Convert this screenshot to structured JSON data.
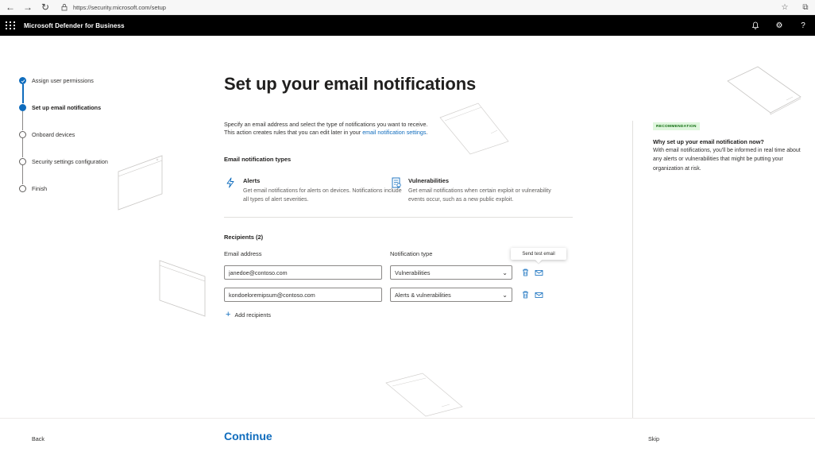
{
  "browser": {
    "url": "https://security.microsoft.com/setup"
  },
  "app": {
    "title": "Microsoft Defender for Business"
  },
  "steps": [
    {
      "label": "Assign user permissions",
      "state": "done"
    },
    {
      "label": "Set up email notifications",
      "state": "current"
    },
    {
      "label": "Onboard devices",
      "state": "pending"
    },
    {
      "label": "Security settings configuration",
      "state": "pending"
    },
    {
      "label": "Finish",
      "state": "pending"
    }
  ],
  "main": {
    "title": "Set up your email notifications",
    "intro_line1": "Specify an email address and select the type of  notifications you want to receive.",
    "intro_line2_prefix": "This action creates rules that you can edit later in your ",
    "intro_link": "email notification settings",
    "intro_suffix": ".",
    "types_heading": "Email notification types",
    "alerts": {
      "title": "Alerts",
      "desc": "Get email notifications for alerts on devices. Notifications include all types of alert severities.",
      "icon": "lightning-icon"
    },
    "vulnerabilities": {
      "title": "Vulnerabilities",
      "desc": "Get email notifications when certain exploit or vulnerability events occur, such as a new public exploit.",
      "icon": "report-icon"
    },
    "recipients_heading": "Recipients (2)",
    "col_email": "Email address",
    "col_type": "Notification type",
    "tooltip": "Send test email",
    "recipients": [
      {
        "email": "janedoe@contoso.com",
        "type": "Vulnerabilities"
      },
      {
        "email": "kondoeloremipsum@contoso.com",
        "type": "Alerts & vulnerabilities"
      }
    ],
    "add_recipients": "Add recipients"
  },
  "panel": {
    "badge": "RECOMMENDATION",
    "heading": "Why set up your email notification now?",
    "body": "With email notifications, you'll be informed in real time about any alerts or vulnerabilities that might be putting your organization at risk."
  },
  "footer": {
    "back": "Back",
    "continue": "Continue",
    "skip": "Skip"
  },
  "colors": {
    "accent": "#0f6cbd",
    "header": "#000000",
    "badge_bg": "#dff6dd"
  }
}
